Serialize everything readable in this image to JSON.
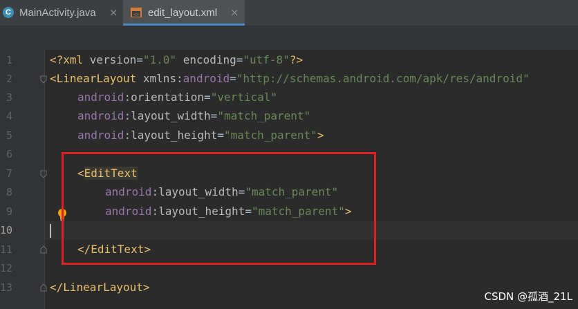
{
  "tabs": [
    {
      "label": "MainActivity.java",
      "icon": "java-class-icon",
      "close": "×"
    },
    {
      "label": "edit_layout.xml",
      "icon": "xml-file-icon",
      "close": "×",
      "active": true
    }
  ],
  "colors": {
    "background": "#2b2b2b",
    "tag": "#e8bf6a",
    "namespace": "#9876aa",
    "string": "#6a8759",
    "highlight_box": "#e02020",
    "accent": "#4a88c7"
  },
  "line_numbers": [
    "1",
    "2",
    "3",
    "4",
    "5",
    "6",
    "7",
    "8",
    "9",
    "10",
    "11",
    "12",
    "13"
  ],
  "code": {
    "l1": {
      "open": "<?xml ",
      "a1": "version",
      "eq1": "=",
      "v1": "\"1.0\"",
      "sp": " ",
      "a2": "encoding",
      "eq2": "=",
      "v2": "\"utf-8\"",
      "close": "?>"
    },
    "l2": {
      "lt": "<",
      "tag": "LinearLayout",
      "sp": " ",
      "a": "xmlns:",
      "ns": "android",
      "eq": "=",
      "v": "\"http://schemas.android.com/apk/res/android\""
    },
    "l3": {
      "ns": "android",
      "colon": ":",
      "a": "orientation",
      "eq": "=",
      "v": "\"vertical\""
    },
    "l4": {
      "ns": "android",
      "colon": ":",
      "a": "layout_width",
      "eq": "=",
      "v": "\"match_parent\""
    },
    "l5": {
      "ns": "android",
      "colon": ":",
      "a": "layout_height",
      "eq": "=",
      "v": "\"match_parent\"",
      "gt": ">"
    },
    "l7": {
      "lt": "<",
      "tag": "EditText"
    },
    "l8": {
      "ns": "android",
      "colon": ":",
      "a": "layout_width",
      "eq": "=",
      "v": "\"match_parent\""
    },
    "l9": {
      "ns": "android",
      "colon": ":",
      "a": "layout_height",
      "eq": "=",
      "v": "\"match_parent\"",
      "gt": ">"
    },
    "l11": {
      "lt": "</",
      "tag": "EditText",
      "gt": ">"
    },
    "l13": {
      "lt": "</",
      "tag": "LinearLayout",
      "gt": ">"
    }
  },
  "watermark": "CSDN @孤酒_21L"
}
